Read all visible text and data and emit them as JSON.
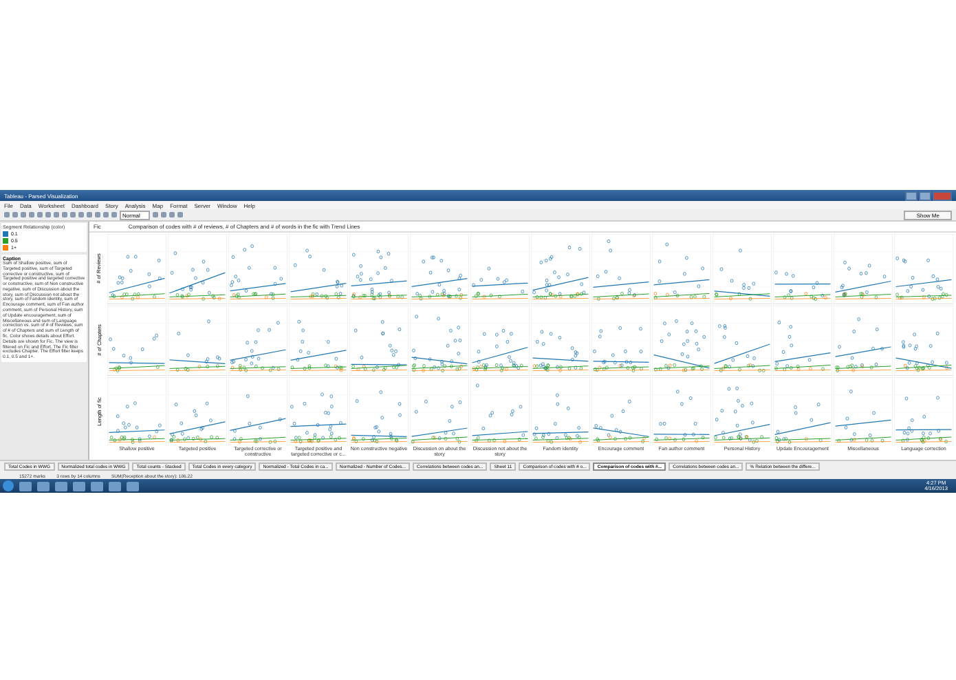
{
  "window": {
    "title": "Tableau - Parsed Visualization"
  },
  "menu": [
    "File",
    "Data",
    "Worksheet",
    "Dashboard",
    "Story",
    "Analysis",
    "Map",
    "Format",
    "Server",
    "Window",
    "Help"
  ],
  "toolbar": {
    "dropdown": "Normal",
    "show_me": "Show Me"
  },
  "legend": {
    "title": "Segment Relationship (color)",
    "items": [
      {
        "label": "0.1",
        "color": "#1f77b4"
      },
      {
        "label": "0.5",
        "color": "#2ca02c"
      },
      {
        "label": "1+",
        "color": "#ff7f0e"
      }
    ]
  },
  "caption": {
    "title": "Caption",
    "text": "Sum of Shallow positive, sum of Targeted positive, sum of Targeted corrective or constructive, sum of Targeted positive and targeted corrective or constructive, sum of Non constructive negative, sum of Discussion about the story, sum of Discussion not about the story, sum of Fandom identity, sum of Encourage comment, sum of Fan author comment, sum of Personal History, sum of Update encouragement, sum of Miscellaneous and sum of Language correction vs. sum of # of Reviews, sum of # of Chapters and sum of Length of fic. Color shows details about Effort. Details are shown for Fic. The view is filtered on Fic and Effort. The Fic filter excludes Chapter. The Effort filter keeps 0.1, 0.5 and 1+."
  },
  "view": {
    "label": "Fic",
    "title": "Comparison of codes with # of reviews, # of Chapters and # of words in the fic with Trend Lines"
  },
  "rows": [
    "# of Reviews",
    "# of Chapters",
    "Length of fic"
  ],
  "columns": [
    "Shallow positive",
    "Targeted positive",
    "Targeted corrective or constructive",
    "Targeted positive and targeted corrective or c...",
    "Non constructive negative",
    "Discussion on about the story",
    "Discussion not about the story",
    "Fandom identity",
    "Encourage comment",
    "Fan author comment",
    "Personal History",
    "Update Encouragement",
    "Miscellaneous",
    "Language correction"
  ],
  "tabs": [
    {
      "label": "Total Codes in WWG",
      "selected": false
    },
    {
      "label": "Normalized total codes in WWG",
      "selected": false
    },
    {
      "label": "Total counts - Stacked",
      "selected": false
    },
    {
      "label": "Total Codes in every category",
      "selected": false
    },
    {
      "label": "Normalized - Total Codes in ca...",
      "selected": false
    },
    {
      "label": "Normalized - Number of Codes...",
      "selected": false
    },
    {
      "label": "Correlations between codes an...",
      "selected": false
    },
    {
      "label": "Sheet 11",
      "selected": false
    },
    {
      "label": "Comparison of codes with # o...",
      "selected": false
    },
    {
      "label": "Comparison of codes with #...",
      "selected": true
    },
    {
      "label": "Correlations between codes an...",
      "selected": false
    },
    {
      "label": "% Relation between the differe...",
      "selected": false
    }
  ],
  "status_bar": [
    "15272 marks",
    "3 rows by 14 columns",
    "SUM(Reception about the story): 186.22"
  ],
  "taskbar": {
    "time": "4:27 PM",
    "date": "4/16/2013"
  }
}
